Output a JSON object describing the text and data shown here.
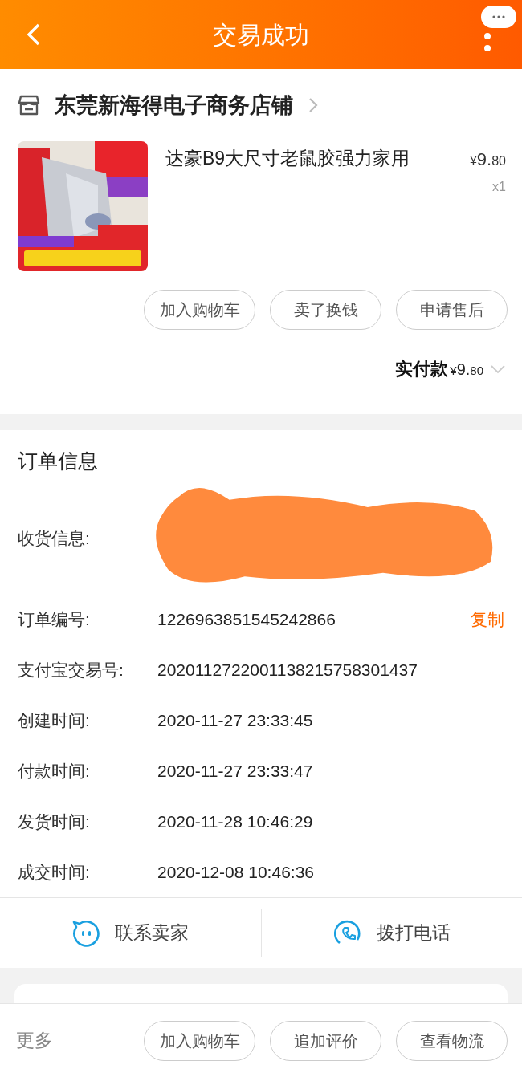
{
  "header": {
    "title": "交易成功"
  },
  "shop": {
    "name": "东莞新海得电子商务店铺"
  },
  "product": {
    "title": "达豪B9大尺寸老鼠胶强力家用",
    "currency": "¥",
    "price_main": "9.",
    "price_cents": "80",
    "quantity": "x1"
  },
  "actions": [
    "加入购物车",
    "卖了换钱",
    "申请售后"
  ],
  "payment": {
    "label": "实付款",
    "currency": "¥",
    "amount_main": "9.",
    "amount_cents": "80"
  },
  "order_info": {
    "title": "订单信息",
    "rows": [
      {
        "kind": "redacted",
        "label": "收货信息:"
      },
      {
        "kind": "text",
        "label": "订单编号:",
        "value": "1226963851545242866",
        "action": "复制"
      },
      {
        "kind": "text",
        "label": "支付宝交易号:",
        "value": "2020112722001138215758301437"
      },
      {
        "kind": "text",
        "label": "创建时间:",
        "value": "2020-11-27 23:33:45"
      },
      {
        "kind": "text",
        "label": "付款时间:",
        "value": "2020-11-27 23:33:47"
      },
      {
        "kind": "text",
        "label": "发货时间:",
        "value": "2020-11-28 10:46:29"
      },
      {
        "kind": "text",
        "label": "成交时间:",
        "value": "2020-12-08 10:46:36"
      }
    ]
  },
  "contact": [
    {
      "kind": "chat",
      "label": "联系卖家"
    },
    {
      "kind": "phone",
      "label": "拨打电话"
    }
  ],
  "bottom_bar": {
    "more": "更多",
    "buttons": [
      "加入购物车",
      "追加评价",
      "查看物流"
    ]
  }
}
